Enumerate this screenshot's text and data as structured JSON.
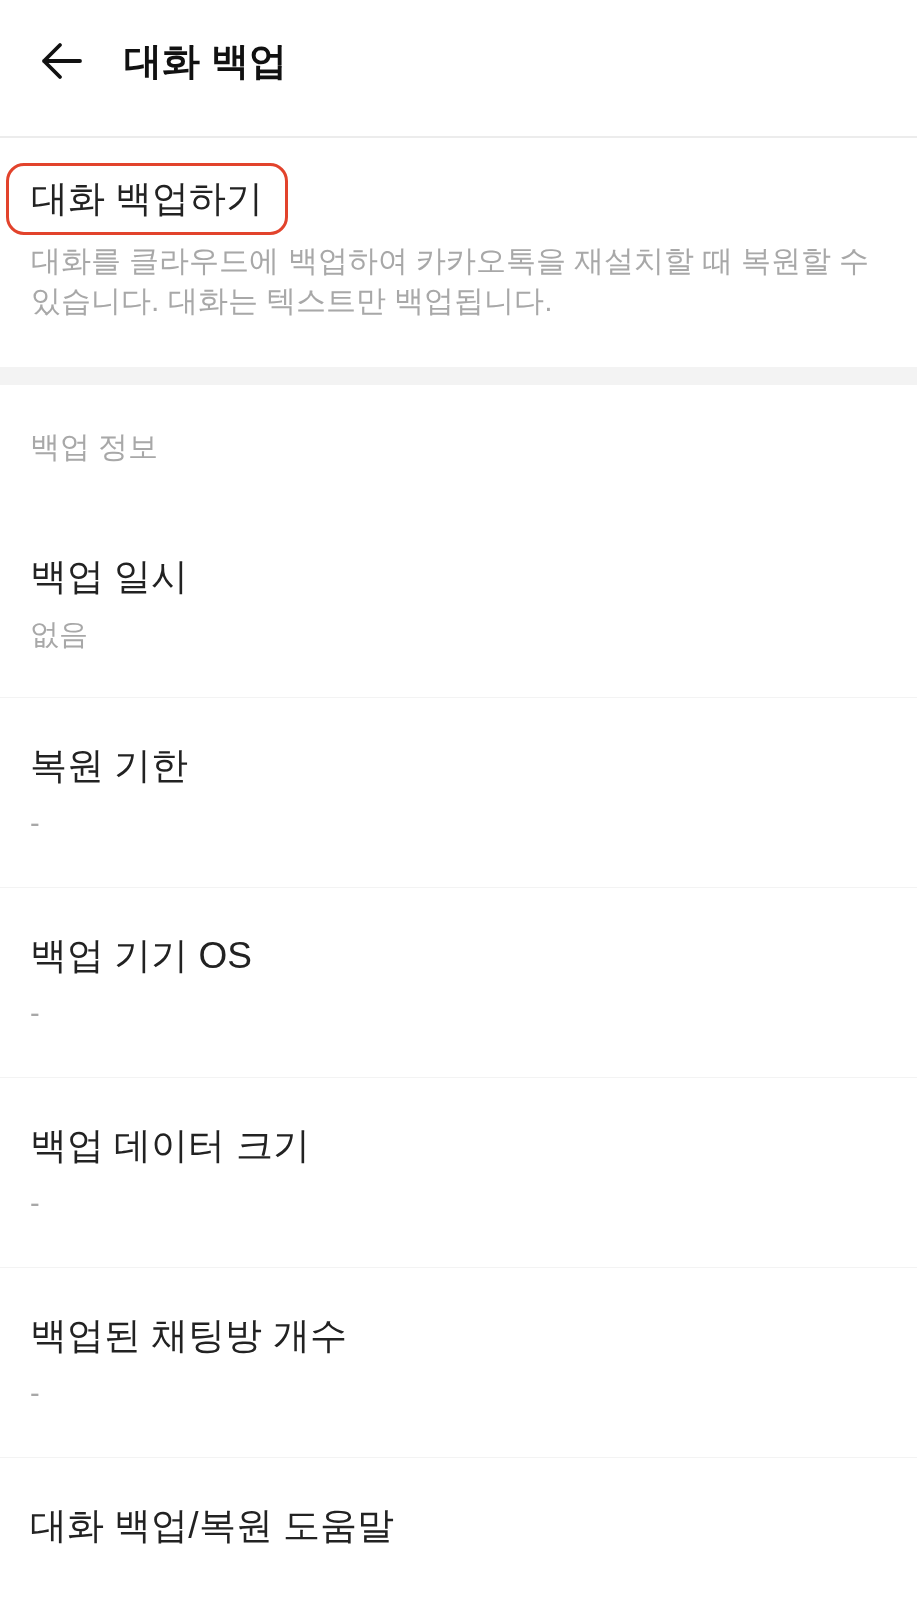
{
  "header": {
    "title": "대화 백업"
  },
  "backup_action": {
    "label": "대화 백업하기",
    "highlighted": true,
    "description": "대화를 클라우드에 백업하여 카카오톡을 재설치할 때 복원할 수 있습니다. 대화는 텍스트만 백업됩니다."
  },
  "backup_info": {
    "title": "백업 정보",
    "items": [
      {
        "kind": "info",
        "label": "백업 일시",
        "value": "없음"
      },
      {
        "kind": "info",
        "label": "복원 기한",
        "value": "-"
      },
      {
        "kind": "info",
        "label": "백업 기기 OS",
        "value": "-"
      },
      {
        "kind": "info",
        "label": "백업 데이터 크기",
        "value": "-"
      },
      {
        "kind": "info",
        "label": "백업된 채팅방 개수",
        "value": "-"
      },
      {
        "kind": "link",
        "label": "대화 백업/복원 도움말"
      }
    ]
  }
}
